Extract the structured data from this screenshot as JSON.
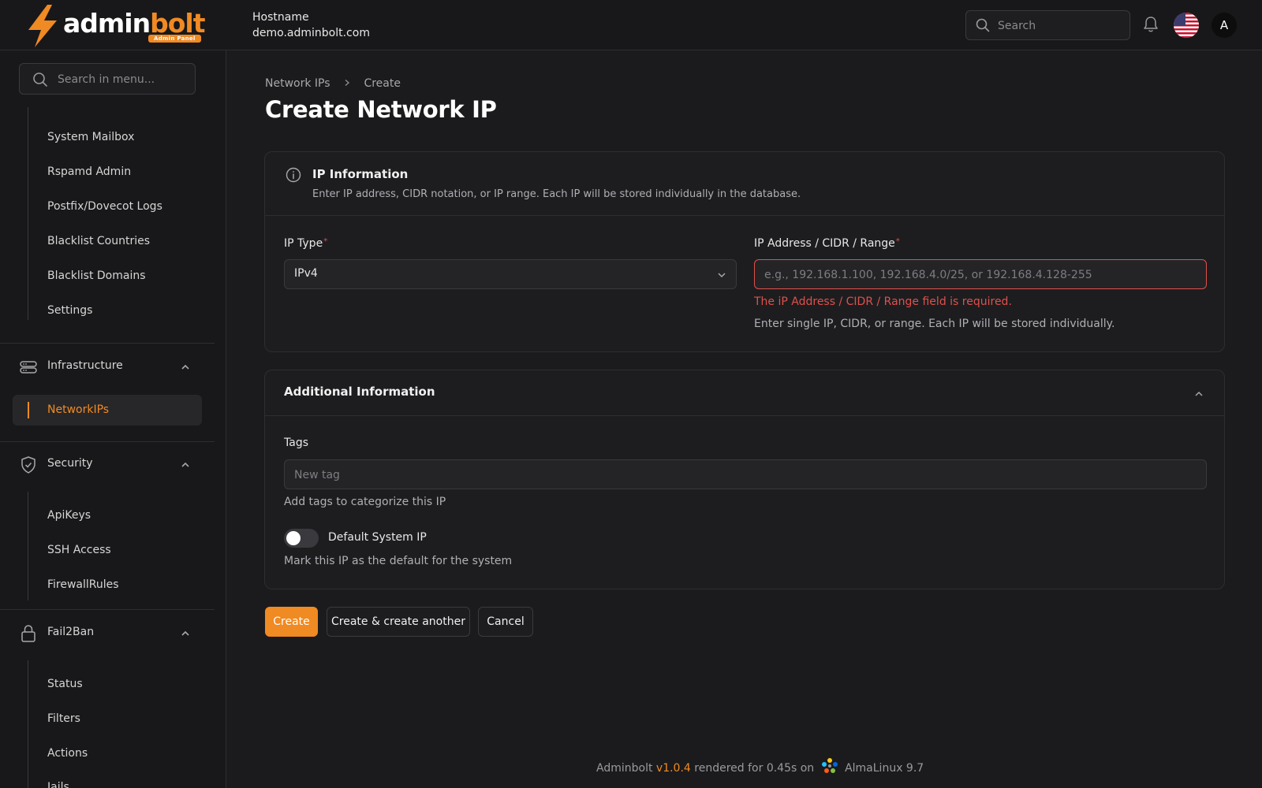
{
  "brand": {
    "name_part1": "admin",
    "name_part2": "bolt",
    "badge": "Admin Panel",
    "accent_color": "#f08a23"
  },
  "header": {
    "host_label": "Hostname",
    "host_value": "demo.adminbolt.com",
    "search_placeholder": "Search",
    "avatar_initial": "A",
    "icons": [
      "search-icon",
      "bell-icon",
      "us-flag-icon"
    ]
  },
  "sidebar": {
    "search_placeholder": "Search in menu...",
    "top_items": [
      {
        "label": "System Mailbox"
      },
      {
        "label": "Rspamd Admin"
      },
      {
        "label": "Postfix/Dovecot Logs"
      },
      {
        "label": "Blacklist Countries"
      },
      {
        "label": "Blacklist Domains"
      },
      {
        "label": "Settings"
      }
    ],
    "groups": [
      {
        "label": "Infrastructure",
        "icon": "server-icon",
        "items": [
          {
            "label": "NetworkIPs",
            "active": true
          }
        ]
      },
      {
        "label": "Security",
        "icon": "shield-check-icon",
        "items": [
          {
            "label": "ApiKeys"
          },
          {
            "label": "SSH Access"
          },
          {
            "label": "FirewallRules"
          }
        ]
      },
      {
        "label": "Fail2Ban",
        "icon": "lock-icon",
        "items": [
          {
            "label": "Status"
          },
          {
            "label": "Filters"
          },
          {
            "label": "Actions"
          },
          {
            "label": "Jails"
          }
        ]
      }
    ]
  },
  "breadcrumb": {
    "items": [
      "Network IPs",
      "Create"
    ]
  },
  "page": {
    "title": "Create Network IP"
  },
  "ip_information": {
    "title": "IP Information",
    "description": "Enter IP address, CIDR notation, or IP range. Each IP will be stored individually in the database.",
    "ip_type_label": "IP Type",
    "ip_type_value": "IPv4",
    "address_label": "IP Address / CIDR / Range",
    "address_placeholder": "e.g., 192.168.1.100, 192.168.4.0/25, or 192.168.4.128-255",
    "address_value": "",
    "address_error": "The iP Address / CIDR / Range field is required.",
    "address_hint": "Enter single IP, CIDR, or range. Each IP will be stored individually.",
    "required_mark": "*"
  },
  "additional_information": {
    "title": "Additional Information",
    "expanded": true,
    "tags_label": "Tags",
    "tags_placeholder": "New tag",
    "tags_hint": "Add tags to categorize this IP",
    "default_label": "Default System IP",
    "default_hint": "Mark this IP as the default for the system",
    "default_enabled": false
  },
  "actions": {
    "create": "Create",
    "create_another": "Create & create another",
    "cancel": "Cancel"
  },
  "footer": {
    "app": "Adminbolt",
    "version": "v1.0.4",
    "rendered": "rendered for 0.45s on",
    "os": "AlmaLinux 9.7"
  }
}
